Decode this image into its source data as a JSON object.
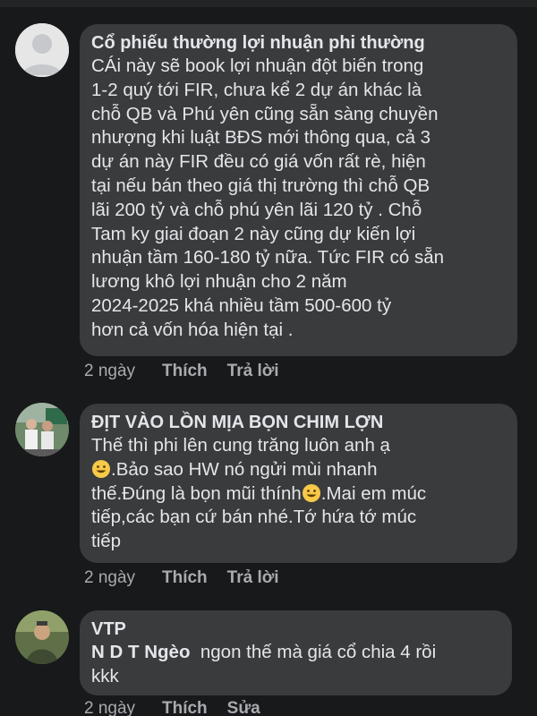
{
  "comments": [
    {
      "author": "Cổ phiếu thường lợi nhuận phi thường",
      "lines": [
        "CÁi này sẽ book lợi nhuận đột biến trong",
        "1-2 quý tới FIR, chưa kể 2 dự án khác là",
        "chỗ QB và Phú yên cũng sẵn sàng chuyền",
        "nhượng khi luật BĐS mới thông qua, cả 3",
        "dự án này FIR đều có giá vốn rất rè, hiện",
        "tại nếu bán theo giá thị trường thì chỗ QB",
        "lãi 200 tỷ và chỗ phú yên lãi 120 tỷ . Chỗ",
        "Tam ky giai đoạn 2 này cũng dự kiến lợi",
        "nhuận tầm 160-180 tỷ nữa. Tức FIR có sẵn",
        "lương khô lợi nhuận cho 2 năm",
        "2024-2025 khá nhiều tầm 500-600 tỷ",
        "hơn cả vốn hóa hiện tại ."
      ],
      "time": "2 ngày",
      "like": "Thích",
      "reply": "Trả lời"
    },
    {
      "author": "ĐỊT VÀO LỒN MỊA BỌN CHIM LỢN",
      "line1": "Thế thì phi lên cung trăng luôn anh ạ",
      "line2": ".Bảo sao HW nó ngửi mùi nhanh",
      "line3": "thế.Đúng là bọn mũi thính",
      "line3b": ".Mai em múc",
      "line4": "tiếp,các bạn cứ bán nhé.Tớ hứa tớ múc",
      "line5": "tiếp",
      "time": "2 ngày",
      "like": "Thích",
      "reply": "Trả lời"
    },
    {
      "author": "VTP",
      "mention": "N D T Ngèo",
      "line1": "ngon thế mà giá cổ chia 4 rồi",
      "line2": "kkk",
      "time": "2 ngày",
      "like": "Thích",
      "edit": "Sửa"
    }
  ]
}
